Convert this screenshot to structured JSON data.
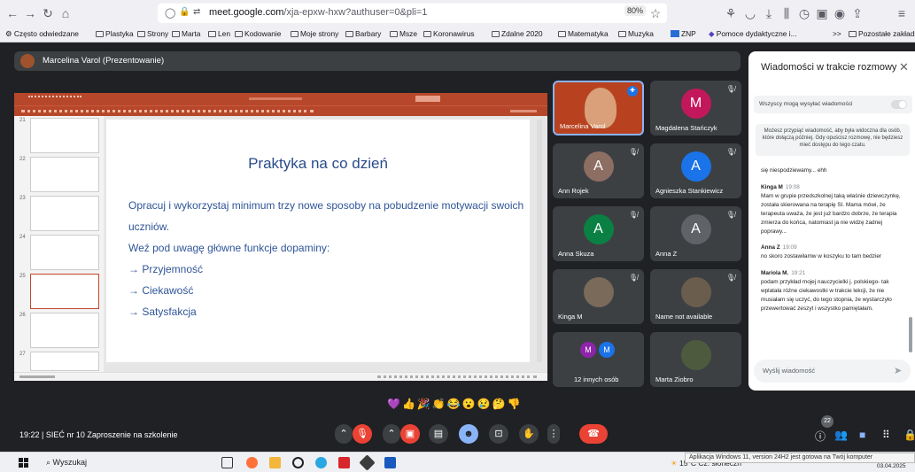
{
  "browser": {
    "url_host": "meet.google.com",
    "url_path": "/xja-epxw-hxw?authuser=0&pli=1",
    "zoom": "80%",
    "bookmarks": [
      "Często odwiedzane",
      "Plastyka",
      "Strony",
      "Marta",
      "Len",
      "Kodowanie",
      "Moje strony",
      "Barbary",
      "Msze",
      "Koronawirus",
      "Zdalne 2020",
      "Matematyka",
      "Muzyka",
      "ZNP",
      "Pomoce dydaktyczne i...",
      "Pozostałe zakładki"
    ],
    "bookmarks_overflow": ">>"
  },
  "meet": {
    "presenting_label": "Marcelina Varol (Prezentowanie)",
    "meeting_time": "19:22",
    "meeting_title": "SIEĆ nr 10 Zaproszenie na szkolenie",
    "participants_count": "22",
    "reactions": "💜👍🎉👏😂😮😢🤔👎"
  },
  "slide": {
    "title": "Praktyka na co dzień",
    "lines": [
      "Opracuj i wykorzystaj minimum trzy nowe sposoby na pobudzenie motywacji swoich",
      "uczniów.",
      "Weź pod uwagę  główne funkcje dopaminy:",
      "→ Przyjemność",
      "→ Ciekawość",
      "→ Satysfakcja"
    ]
  },
  "participants": [
    {
      "name": "Marcelina Varol",
      "initial": "",
      "color": "#b8421f"
    },
    {
      "name": "Magdalena Stańczyk",
      "initial": "M",
      "color": "#c2185b"
    },
    {
      "name": "Ann Rojek",
      "initial": "A",
      "color": "#8d6e63"
    },
    {
      "name": "Agnieszka Stankiewicz",
      "initial": "A",
      "color": "#1a73e8"
    },
    {
      "name": "Anna Skuza",
      "initial": "A",
      "color": "#0b8043"
    },
    {
      "name": "Anna Z",
      "initial": "A",
      "color": "#5f6368"
    },
    {
      "name": "Kinga M",
      "initial": "",
      "color": "#7a6a5a"
    },
    {
      "name": "Name not available",
      "initial": "",
      "color": "#6b5d4d"
    },
    {
      "name": "12 innych osób",
      "initial": "M",
      "color": "#8e24aa"
    },
    {
      "name": "Marta Ziobro",
      "initial": "",
      "color": "#4e5a3e"
    }
  ],
  "chat": {
    "title": "Wiadomości w trakcie rozmowy",
    "permission_label": "Wszyscy mogą wysyłać wiadomości",
    "info": "Możesz przypiąć wiadomość, aby była widoczna dla osób, które dołączą później. Gdy opuścisz rozmowę, nie będziesz mieć dostępu do tego czatu.",
    "input_placeholder": "Wyślij wiadomość",
    "messages": [
      {
        "author": "",
        "time": "",
        "text": "się niespodziewamy... ehh"
      },
      {
        "author": "Kinga M",
        "time": "19:08",
        "text": "Mam w grupie przedszkolnej taką właśnie dziewczynkę, została skierowana na terapię SI. Mama mówi, że terapeuta uważa, że jest już bardzo dobrze, że terapia zmierza do końca, natomiast ja nie widzę żadnej poprawy..."
      },
      {
        "author": "Anna Z",
        "time": "19:09",
        "text": "no skoro zostawiłamw w koszyku to tam bedzier"
      },
      {
        "author": "Mariola M.",
        "time": "19:21",
        "text": "podam przykład mojej nauczycielki j. polskiego- tak wplatała różne ciekawostki w trakcie lekcji, że nie musiałam się uczyć, do tego stopnia, że wystarczyło przewertować zeszyt i wszystko pamiętałam."
      }
    ]
  },
  "taskbar": {
    "search": "Wyszukaj",
    "weather": "15°C  Cz. słoneczn",
    "toast": "Aplikacja Windows 11, version 24H2 jest gotowa na Twój komputer",
    "date": "03.04.2025"
  },
  "colors": {
    "ppt_red": "#b7472a",
    "meet_bg": "#202124",
    "tile_bg": "#3c4043",
    "hangup": "#ea4335"
  }
}
